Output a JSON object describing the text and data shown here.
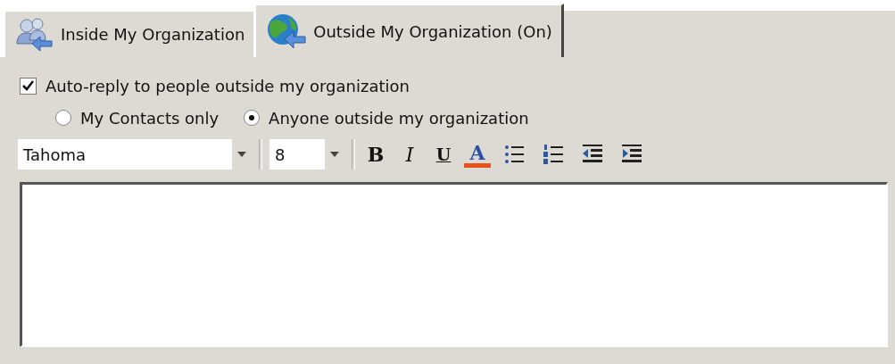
{
  "tabs": [
    {
      "label": "Inside My Organization",
      "kind": "people",
      "selected": false
    },
    {
      "label": "Outside My Organization (On)",
      "kind": "globe",
      "selected": true
    }
  ],
  "auto_reply": {
    "label": "Auto-reply to people outside my organization",
    "checked": true
  },
  "audience": [
    {
      "label": "My Contacts only",
      "selected": false
    },
    {
      "label": "Anyone outside my organization",
      "selected": true
    }
  ],
  "toolbar": {
    "font": {
      "value": "Tahoma"
    },
    "size": {
      "value": "8"
    },
    "buttons": [
      {
        "kind": "bold",
        "label": "B"
      },
      {
        "kind": "italic",
        "label": "I"
      },
      {
        "kind": "underline",
        "label": "U"
      },
      {
        "kind": "color",
        "label": "A",
        "color": "#e8501c"
      },
      {
        "kind": "bullets"
      },
      {
        "kind": "numbering"
      },
      {
        "kind": "outdent"
      },
      {
        "kind": "indent"
      }
    ]
  }
}
